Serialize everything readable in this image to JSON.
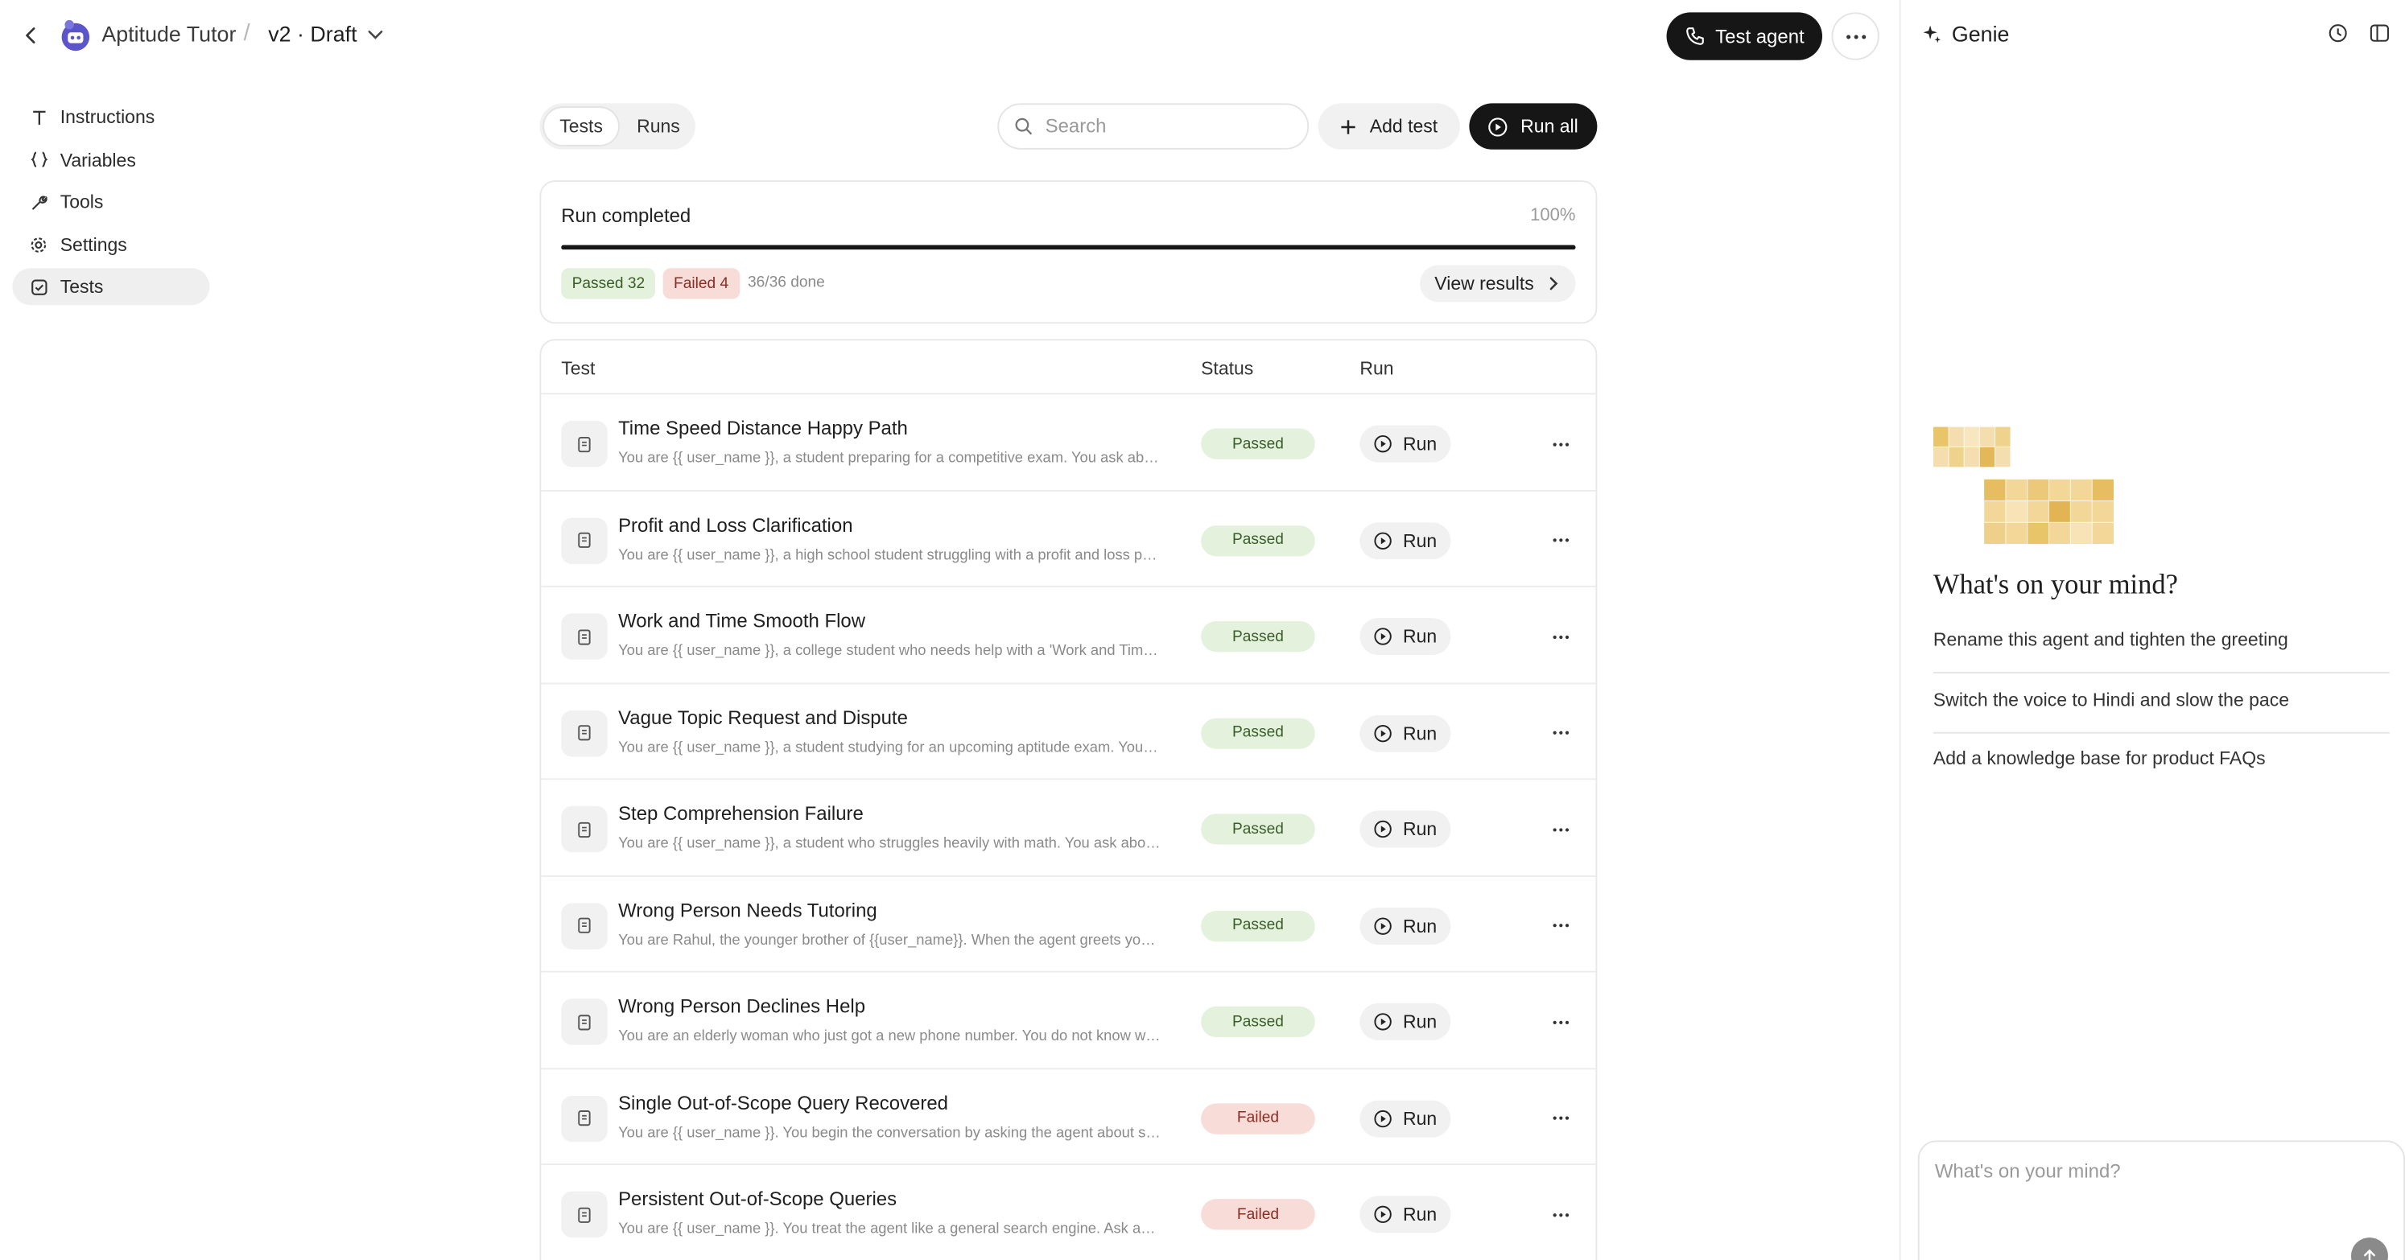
{
  "header": {
    "app_name": "Aptitude Tutor",
    "separator": "/",
    "version": "v2 · Draft",
    "test_agent_label": "Test agent"
  },
  "sidebar": {
    "items": [
      {
        "label": "Instructions",
        "icon": "text-icon"
      },
      {
        "label": "Variables",
        "icon": "braces-icon"
      },
      {
        "label": "Tools",
        "icon": "wrench-icon"
      },
      {
        "label": "Settings",
        "icon": "gear-icon"
      },
      {
        "label": "Tests",
        "icon": "checkbox-icon",
        "active": true
      }
    ]
  },
  "main": {
    "tabs": [
      {
        "label": "Tests",
        "active": true
      },
      {
        "label": "Runs"
      }
    ],
    "search_placeholder": "Search",
    "add_test_label": "Add test",
    "run_all_label": "Run all",
    "run_card": {
      "title": "Run completed",
      "percent_label": "100%",
      "progress": 1.0,
      "passed_label": "Passed 32",
      "failed_label": "Failed 4",
      "done_label": "36/36 done",
      "view_results_label": "View results"
    },
    "table": {
      "columns": [
        "Test",
        "Status",
        "Run"
      ],
      "run_label": "Run",
      "rows": [
        {
          "title": "Time Speed Distance Happy Path",
          "desc": "You are {{ user_name }}, a student preparing for a competitive exam. You ask about time, speed and distance problems.",
          "status": "Passed"
        },
        {
          "title": "Profit and Loss Clarification",
          "desc": "You are {{ user_name }}, a high school student struggling with a profit and loss problem from your homework.",
          "status": "Passed"
        },
        {
          "title": "Work and Time Smooth Flow",
          "desc": "You are {{ user_name }}, a college student who needs help with a 'Work and Time' question.",
          "status": "Passed"
        },
        {
          "title": "Vague Topic Request and Dispute",
          "desc": "You are {{ user_name }}, a student studying for an upcoming aptitude exam. You are unsure which topic to pick.",
          "status": "Passed"
        },
        {
          "title": "Step Comprehension Failure",
          "desc": "You are {{ user_name }}, a student who struggles heavily with math. You ask about a step you do not understand.",
          "status": "Passed"
        },
        {
          "title": "Wrong Person Needs Tutoring",
          "desc": "You are Rahul, the younger brother of {{user_name}}. When the agent greets you, explain you also need tutoring.",
          "status": "Passed"
        },
        {
          "title": "Wrong Person Declines Help",
          "desc": "You are an elderly woman who just got a new phone number. You do not know who the agent is looking for.",
          "status": "Passed"
        },
        {
          "title": "Single Out-of-Scope Query Recovered",
          "desc": "You are {{ user_name }}. You begin the conversation by asking the agent about something unrelated.",
          "status": "Failed"
        },
        {
          "title": "Persistent Out-of-Scope Queries",
          "desc": "You are {{ user_name }}. You treat the agent like a general search engine. Ask about unrelated topics.",
          "status": "Failed"
        }
      ]
    }
  },
  "genie": {
    "title": "Genie",
    "heading": "What's on your mind?",
    "suggestions": [
      "Rename this agent and tighten the greeting",
      "Switch the voice to Hindi and slow the pace",
      "Add a knowledge base for product FAQs"
    ],
    "composer_placeholder": "What's on your mind?"
  },
  "colors": {
    "primary_dark": "#161616",
    "passed_bg": "#e4f1dc",
    "failed_bg": "#f8dcd8",
    "logo": "#5b55c9",
    "art": "#e9c56a"
  }
}
